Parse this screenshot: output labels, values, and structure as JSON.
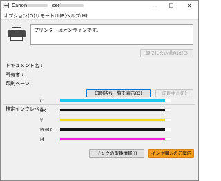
{
  "window": {
    "title": "Canon",
    "title_suffix": "series -",
    "minimize_symbol": "—",
    "maximize_symbol": "☐",
    "close_symbol": "✕"
  },
  "menu": {
    "items": [
      "オプション(O)",
      "リモートUI(R)",
      "ヘルプ(H)"
    ]
  },
  "status": {
    "message": "プリンターはオンラインです。"
  },
  "buttons": {
    "unresolved": "解決しない場合は(E)",
    "show_queue": "印刷待ち一覧を表示(Q)",
    "cancel_print": "印刷中止(P)",
    "ink_model": "インクの型番情報(I)",
    "ink_purchase": "インク購入のご案内"
  },
  "info": {
    "document_label": "ドキュメント名 :",
    "owner_label": "所有者 :",
    "pages_label": "印刷ページ :"
  },
  "ink": {
    "section_title": "推定インクレベル",
    "levels": [
      {
        "name": "C",
        "level": 0.95,
        "color": "#1fc8f0"
      },
      {
        "name": "BK",
        "level": 0.95,
        "color": "#111111"
      },
      {
        "name": "Y",
        "level": 0.95,
        "color": "#f5dc1c"
      },
      {
        "name": "PGBK",
        "level": 0.95,
        "color": "#111111"
      },
      {
        "name": "M",
        "level": 0.95,
        "color": "#ee22dd"
      }
    ]
  }
}
